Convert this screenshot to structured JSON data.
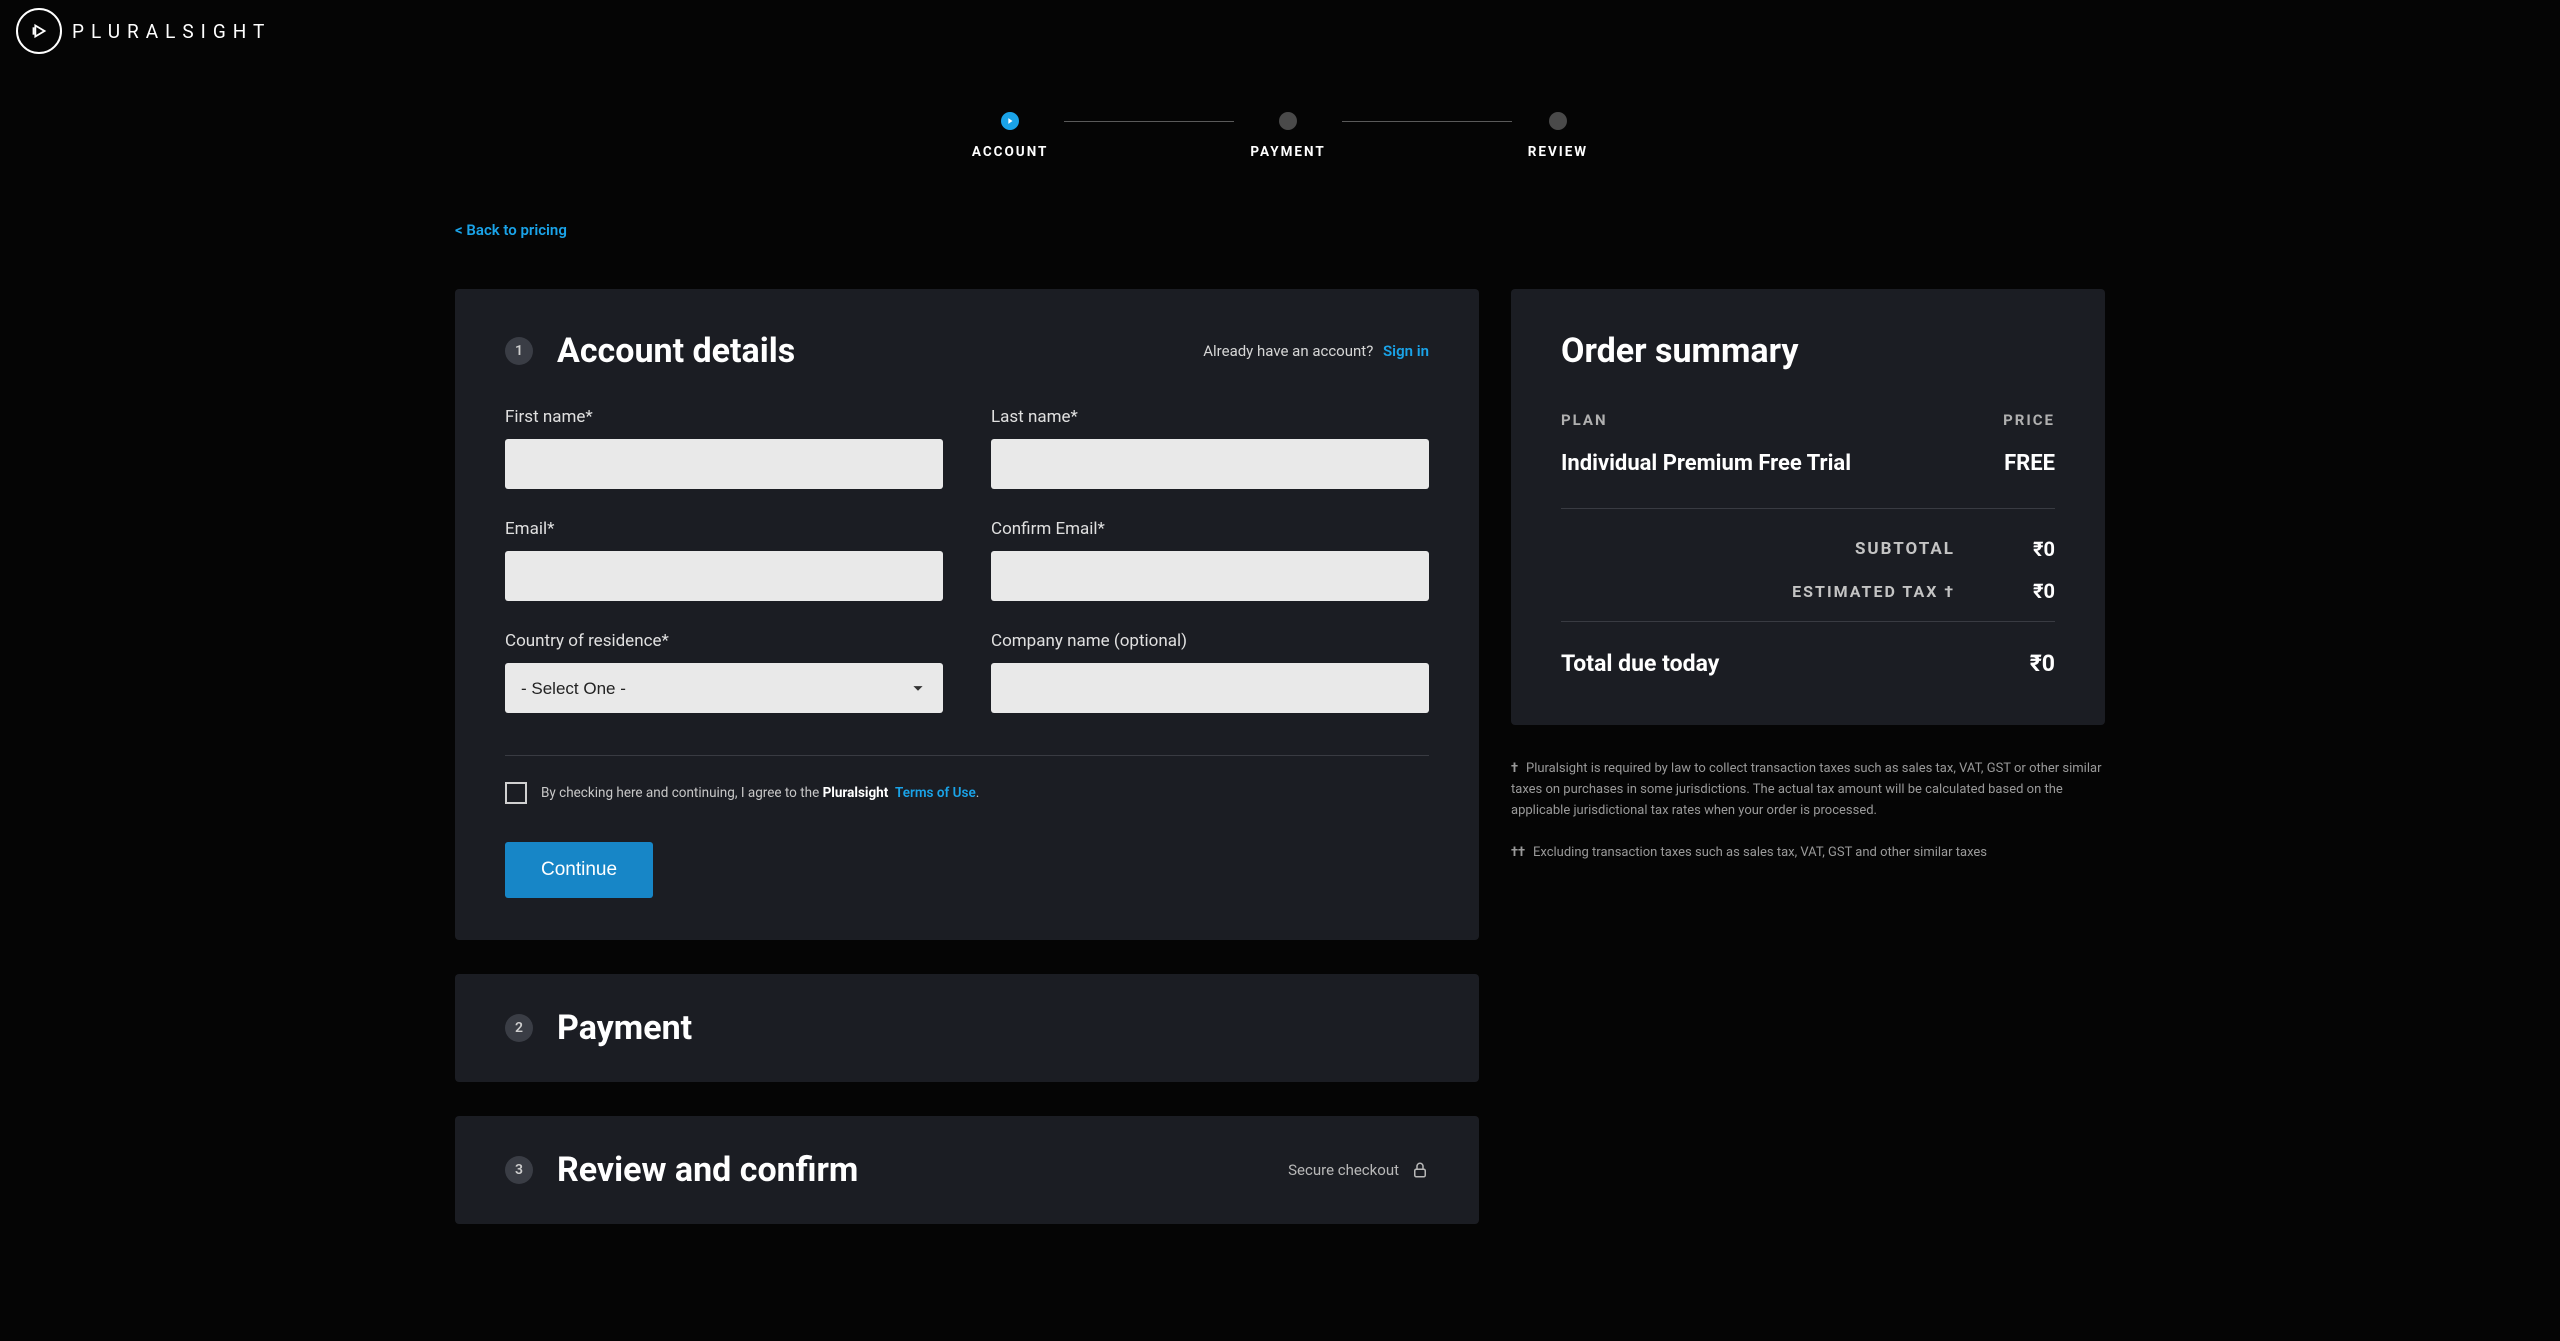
{
  "brand": "PLURALSIGHT",
  "stepper": {
    "steps": [
      {
        "label": "ACCOUNT"
      },
      {
        "label": "PAYMENT"
      },
      {
        "label": "REVIEW"
      }
    ]
  },
  "back_link": "< Back to pricing",
  "account_details": {
    "step_num": "1",
    "title": "Account details",
    "already_text": "Already have an account?",
    "signin": "Sign in",
    "fields": {
      "first_name": "First name*",
      "last_name": "Last name*",
      "email": "Email*",
      "confirm_email": "Confirm Email*",
      "country": "Country of residence*",
      "country_placeholder": "- Select One -",
      "company": "Company name (optional)"
    },
    "terms_prefix": "By checking here and continuing, I agree to the ",
    "terms_brand": "Pluralsight",
    "terms_link": "Terms of Use",
    "continue": "Continue"
  },
  "payment": {
    "step_num": "2",
    "title": "Payment"
  },
  "review": {
    "step_num": "3",
    "title": "Review and confirm",
    "secure": "Secure checkout"
  },
  "summary": {
    "title": "Order summary",
    "plan_header": "PLAN",
    "price_header": "PRICE",
    "plan_name": "Individual Premium Free Trial",
    "plan_price": "FREE",
    "subtotal_label": "SUBTOTAL",
    "subtotal_value": "₹0",
    "tax_label": "ESTIMATED TAX †",
    "tax_value": "₹0",
    "total_label": "Total due today",
    "total_value": "₹0"
  },
  "footnotes": {
    "f1_marker": "†",
    "f1_text": "Pluralsight is required by law to collect transaction taxes such as sales tax, VAT, GST or other similar taxes on purchases in some jurisdictions. The actual tax amount will be calculated based on the applicable jurisdictional tax rates when your order is processed.",
    "f2_marker": "††",
    "f2_text": "Excluding transaction taxes such as sales tax, VAT, GST and other similar taxes"
  }
}
